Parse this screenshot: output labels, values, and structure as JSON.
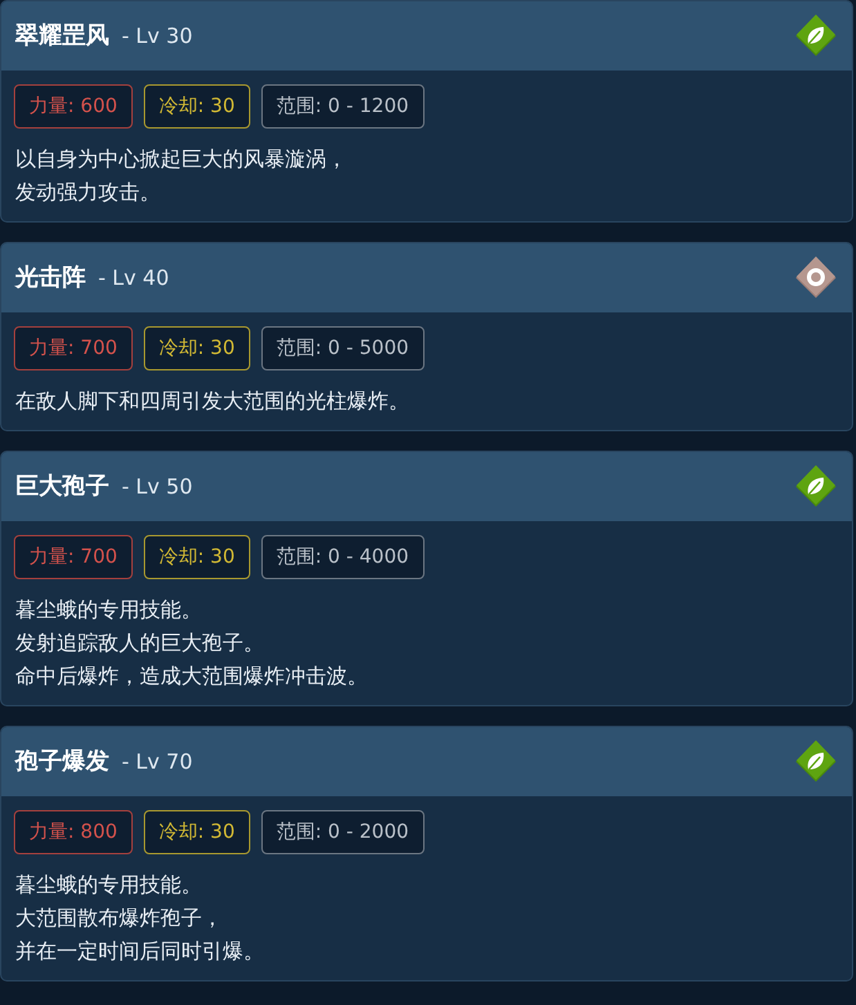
{
  "skills": [
    {
      "name": "翠耀罡风",
      "level": "- Lv 30",
      "kind": "leaf",
      "stats": [
        {
          "kind": "power",
          "text": "力量: 600"
        },
        {
          "kind": "cooldown",
          "text": "冷却: 30"
        },
        {
          "kind": "range",
          "text": "范围: 0 - 1200"
        }
      ],
      "description": [
        "以自身为中心掀起巨大的风暴漩涡，",
        "发动强力攻击。"
      ]
    },
    {
      "name": "光击阵",
      "level": "- Lv 40",
      "kind": "target",
      "stats": [
        {
          "kind": "power",
          "text": "力量: 700"
        },
        {
          "kind": "cooldown",
          "text": "冷却: 30"
        },
        {
          "kind": "range",
          "text": "范围: 0 - 5000"
        }
      ],
      "description": [
        "在敌人脚下和四周引发大范围的光柱爆炸。"
      ]
    },
    {
      "name": "巨大孢子",
      "level": "- Lv 50",
      "kind": "leaf",
      "stats": [
        {
          "kind": "power",
          "text": "力量: 700"
        },
        {
          "kind": "cooldown",
          "text": "冷却: 30"
        },
        {
          "kind": "range",
          "text": "范围: 0 - 4000"
        }
      ],
      "description": [
        "暮尘蛾的专用技能。",
        "发射追踪敌人的巨大孢子。",
        "命中后爆炸，造成大范围爆炸冲击波。"
      ]
    },
    {
      "name": "孢子爆发",
      "level": "- Lv 70",
      "kind": "leaf",
      "stats": [
        {
          "kind": "power",
          "text": "力量: 800"
        },
        {
          "kind": "cooldown",
          "text": "冷却: 30"
        },
        {
          "kind": "range",
          "text": "范围: 0 - 2000"
        }
      ],
      "description": [
        "暮尘蛾的专用技能。",
        "大范围散布爆炸孢子，",
        "并在一定时间后同时引爆。"
      ]
    }
  ]
}
